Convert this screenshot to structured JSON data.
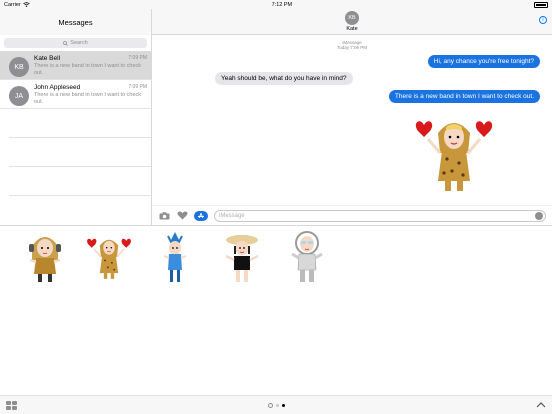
{
  "status": {
    "carrier": "Carrier",
    "time": "7:12 PM"
  },
  "sidebar": {
    "title": "Messages",
    "search_placeholder": "Search",
    "conversations": [
      {
        "initials": "KB",
        "name": "Kate Bell",
        "time": "7:09 PM",
        "preview": "There is a new band in town I want to check out."
      },
      {
        "initials": "JA",
        "name": "John Appleseed",
        "time": "7:09 PM",
        "preview": "There is a new band in town I want to check out."
      }
    ]
  },
  "chat": {
    "contact_initials": "KB",
    "contact_name": "Kate",
    "service": "iMessage",
    "timestamp": "Today 7:09 PM",
    "messages": [
      {
        "from": "me",
        "text": "Hi, any chance you're free tonight?"
      },
      {
        "from": "them",
        "text": "Yeah should be, what do you have in mind?"
      },
      {
        "from": "me",
        "text": "There is a new band in town I want to check out."
      }
    ],
    "input_placeholder": "iMessage"
  },
  "colors": {
    "accent": "#1a73e0",
    "bubble_in": "#e5e5ea",
    "leopard": "#c9973b"
  }
}
